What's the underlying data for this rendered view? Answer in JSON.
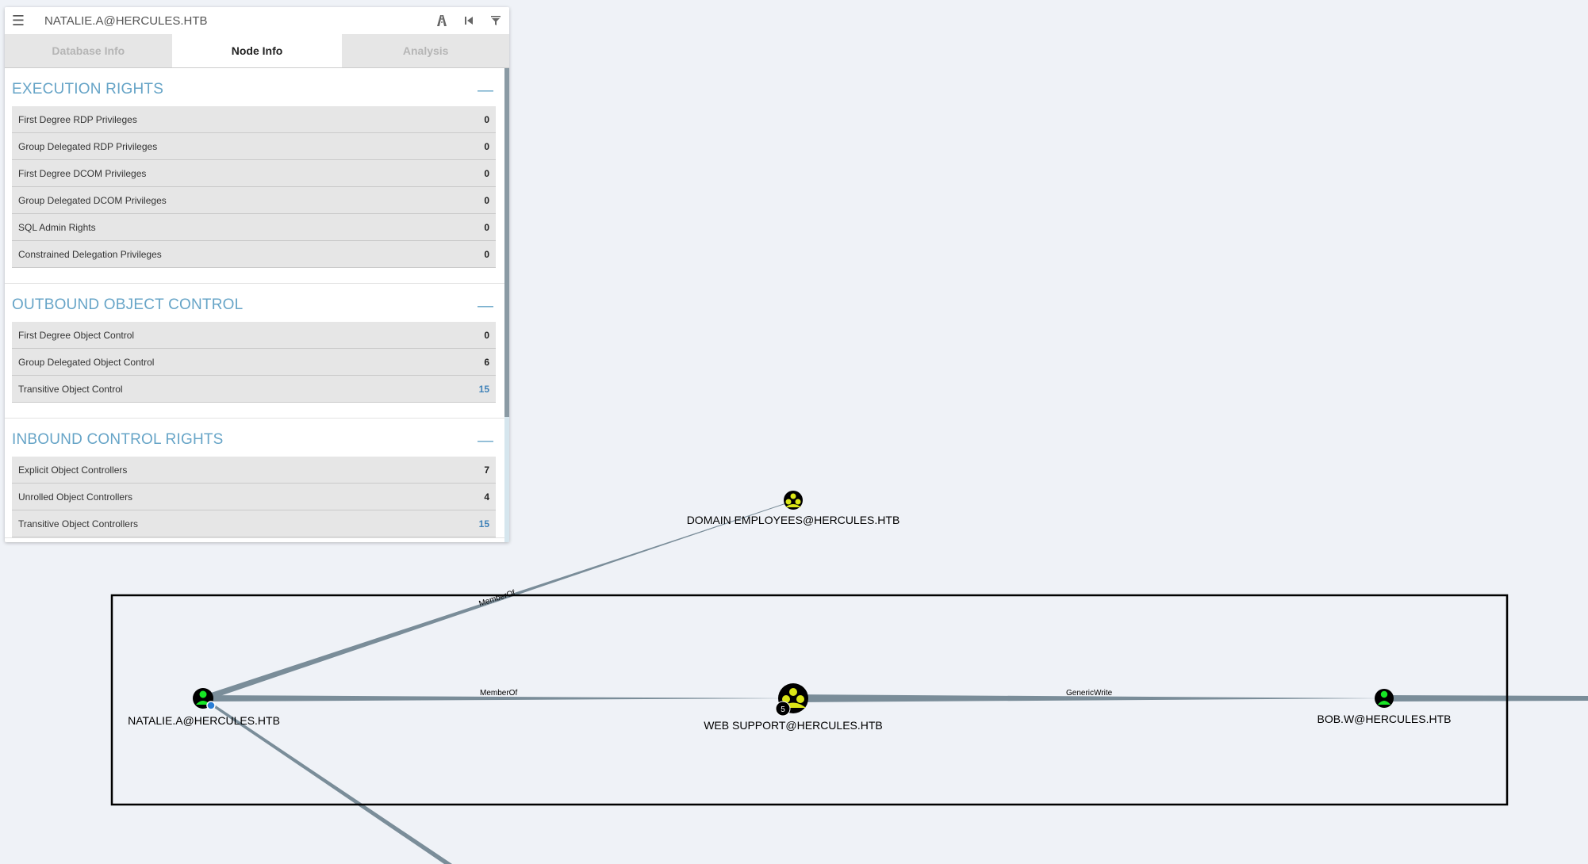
{
  "search": {
    "value": "NATALIE.A@HERCULES.HTB"
  },
  "tabs": [
    {
      "label": "Database Info"
    },
    {
      "label": "Node Info"
    },
    {
      "label": "Analysis"
    }
  ],
  "sections": [
    {
      "title": "EXECUTION RIGHTS",
      "collapse": "—",
      "rows": [
        {
          "label": "First Degree RDP Privileges",
          "value": "0"
        },
        {
          "label": "Group Delegated RDP Privileges",
          "value": "0"
        },
        {
          "label": "First Degree DCOM Privileges",
          "value": "0"
        },
        {
          "label": "Group Delegated DCOM Privileges",
          "value": "0"
        },
        {
          "label": "SQL Admin Rights",
          "value": "0"
        },
        {
          "label": "Constrained Delegation Privileges",
          "value": "0"
        }
      ]
    },
    {
      "title": "OUTBOUND OBJECT CONTROL",
      "collapse": "—",
      "rows": [
        {
          "label": "First Degree Object Control",
          "value": "0"
        },
        {
          "label": "Group Delegated Object Control",
          "value": "6"
        },
        {
          "label": "Transitive Object Control",
          "value": "15"
        }
      ]
    },
    {
      "title": "INBOUND CONTROL RIGHTS",
      "collapse": "—",
      "rows": [
        {
          "label": "Explicit Object Controllers",
          "value": "7"
        },
        {
          "label": "Unrolled Object Controllers",
          "value": "4"
        },
        {
          "label": "Transitive Object Controllers",
          "value": "15"
        }
      ]
    }
  ],
  "graph": {
    "nodes": [
      {
        "label": "DOMAIN EMPLOYEES@HERCULES.HTB",
        "type": "group"
      },
      {
        "label": "NATALIE.A@HERCULES.HTB",
        "type": "user"
      },
      {
        "label": "WEB SUPPORT@HERCULES.HTB",
        "type": "group",
        "badge": "5"
      },
      {
        "label": "BOB.W@HERCULES.HTB",
        "type": "user"
      }
    ],
    "edges": [
      {
        "label": "MemberOf"
      },
      {
        "label": "MemberOf"
      },
      {
        "label": "GenericWrite"
      }
    ]
  },
  "colors": {
    "accent": "#66a4c7",
    "edge": "#7a8d99",
    "user_node": "#17e625",
    "group_node": "#dbe617",
    "highlight_value": "#3f82b8"
  }
}
